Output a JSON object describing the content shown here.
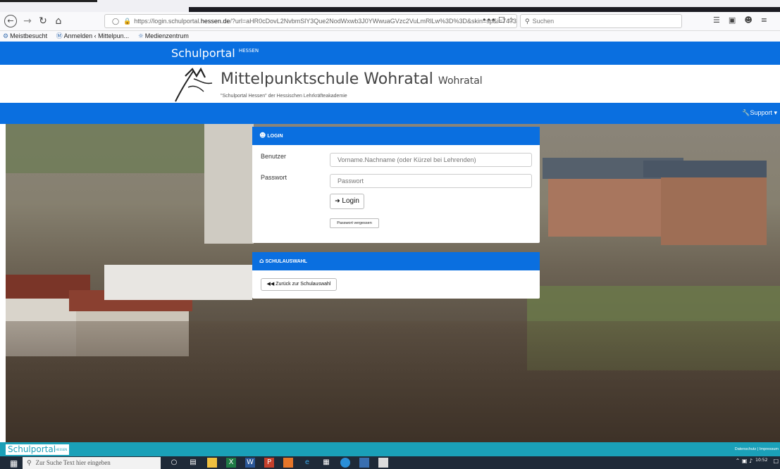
{
  "browser": {
    "url_prefix": "https://login.schulportal.",
    "url_domain": "hessen.de",
    "url_rest": "/?url=aHR0cDovL2NvbmSlY3Que2NodWxwb3J0YWwuaGVzc2VuLmRlLw%3D%3D&skin=sp&i=7473",
    "url_actions": "••• ☐ ☆",
    "search_placeholder": "Suchen",
    "bookmarks": [
      {
        "label": "Meistbesucht",
        "icon": "gear-icon"
      },
      {
        "label": "Anmelden ‹ Mittelpun...",
        "icon": "wordpress-icon"
      },
      {
        "label": "Medienzentrum",
        "icon": "globe-icon"
      }
    ]
  },
  "portal": {
    "brand": "Schulportal",
    "brand_sup": "HESSEN",
    "school_name": "Mittelpunktschule Wohratal",
    "school_location": "Wohratal",
    "school_subtitle": "\"Schulportal Hessen\" der Hessischen Lehrkräfteakademie",
    "support_label": "Support"
  },
  "login": {
    "header": "LOGIN",
    "user_label": "Benutzer",
    "user_placeholder": "Vorname.Nachname (oder Kürzel bei Lehrenden)",
    "password_label": "Passwort",
    "password_placeholder": "Passwort",
    "login_button": "Login",
    "forgot_button": "Passwort vergessen"
  },
  "school_select": {
    "header": "SCHULAUSWAHL",
    "back_button": "Zurück zur Schulauswahl"
  },
  "footer": {
    "brand": "Schulportal",
    "brand_sup": "HESSEN",
    "links": "Datenschutz | Impressum"
  },
  "taskbar": {
    "search_placeholder": "Zur Suche Text hier eingeben",
    "time": "10:52"
  },
  "colors": {
    "portal_blue": "#0a6fe0",
    "footer_teal": "#1aa0b8"
  }
}
